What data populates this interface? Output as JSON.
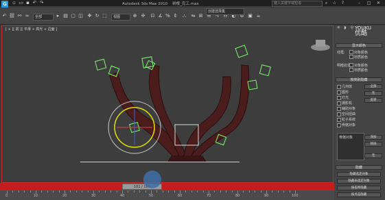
{
  "title_bar": {
    "app_title": "Autodesk 3ds Max  2010",
    "file_title": "树根_完工.max",
    "search_placeholder": "键入关键字或短语"
  },
  "toolbar": {
    "selection_filter": "全部",
    "view_dropdown": "视图",
    "selection_set": "创建选择集"
  },
  "viewport": {
    "label": "[ + ][ 前 ][ 平滑 + 高光 + 边面 ]"
  },
  "watermark": {
    "line1": "YOUKU",
    "line2": "优酷"
  },
  "panel": {
    "rollout_display_color": "显示颜色",
    "shaded_label": "线框:",
    "shaded_label2": "明暗处理:",
    "obj_color": "对象颜色",
    "mat_color": "材质颜色",
    "rollout_hide_by_category": "按类别隐藏",
    "categories": [
      "几何体",
      "图形",
      "灯光",
      "摄影机",
      "辅助对象",
      "空间扭曲",
      "粒子系统",
      "骨骼对象"
    ],
    "btn_all": "全部",
    "btn_none": "无",
    "btn_invert": "反转",
    "list_item": "骨骼对象",
    "btn_add": "添加",
    "btn_remove": "移除",
    "btn_none2": "无",
    "rollout_hide": "隐藏",
    "btn_hide_selected": "隐藏选定对象",
    "btn_hide_unselected": "隐藏未选定对象",
    "btn_hide_by_name": "按名称隐藏",
    "btn_hide_by_hit": "按点击隐藏"
  },
  "timeline": {
    "slider_text": "101 / 100",
    "ticks": [
      "0",
      "10",
      "20",
      "30",
      "40",
      "50",
      "60",
      "70",
      "80",
      "90",
      "100"
    ]
  },
  "colors": {
    "accent_red": "#c92a2a",
    "helper_green": "#7cff6b",
    "circle_yellow": "#e8e000",
    "bone_dark": "#3a1515"
  }
}
